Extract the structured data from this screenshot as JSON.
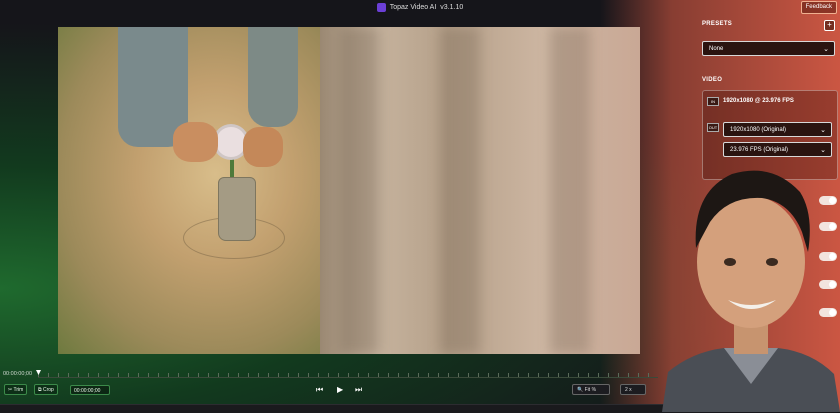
{
  "title_bar": {
    "app_name": "Topaz Video AI",
    "version": "v3.1.10",
    "feedback_label": "Feedback"
  },
  "right_panel": {
    "presets_label": "PRESETS",
    "add_icon": "plus-icon",
    "preset_value": "None",
    "video_label": "VIDEO",
    "input_badge": "IN",
    "input_info": "1920x1080 @ 23.976 FPS",
    "output_badge": "OUT",
    "output_resolution": "1920x1080 (Original)",
    "output_fps": "23.976 FPS (Original)"
  },
  "timeline": {
    "start_time": "00:00:00;00",
    "trim_label": "Trim",
    "crop_label": "Crop",
    "timecode_value": "00:00:00;00",
    "zoom_label": "Fit %",
    "speed_label": "2 x"
  },
  "colors": {
    "accent_green": "#3c8a4a",
    "accent_orange": "#e8664a",
    "logo_purple": "#6b3fd6"
  }
}
